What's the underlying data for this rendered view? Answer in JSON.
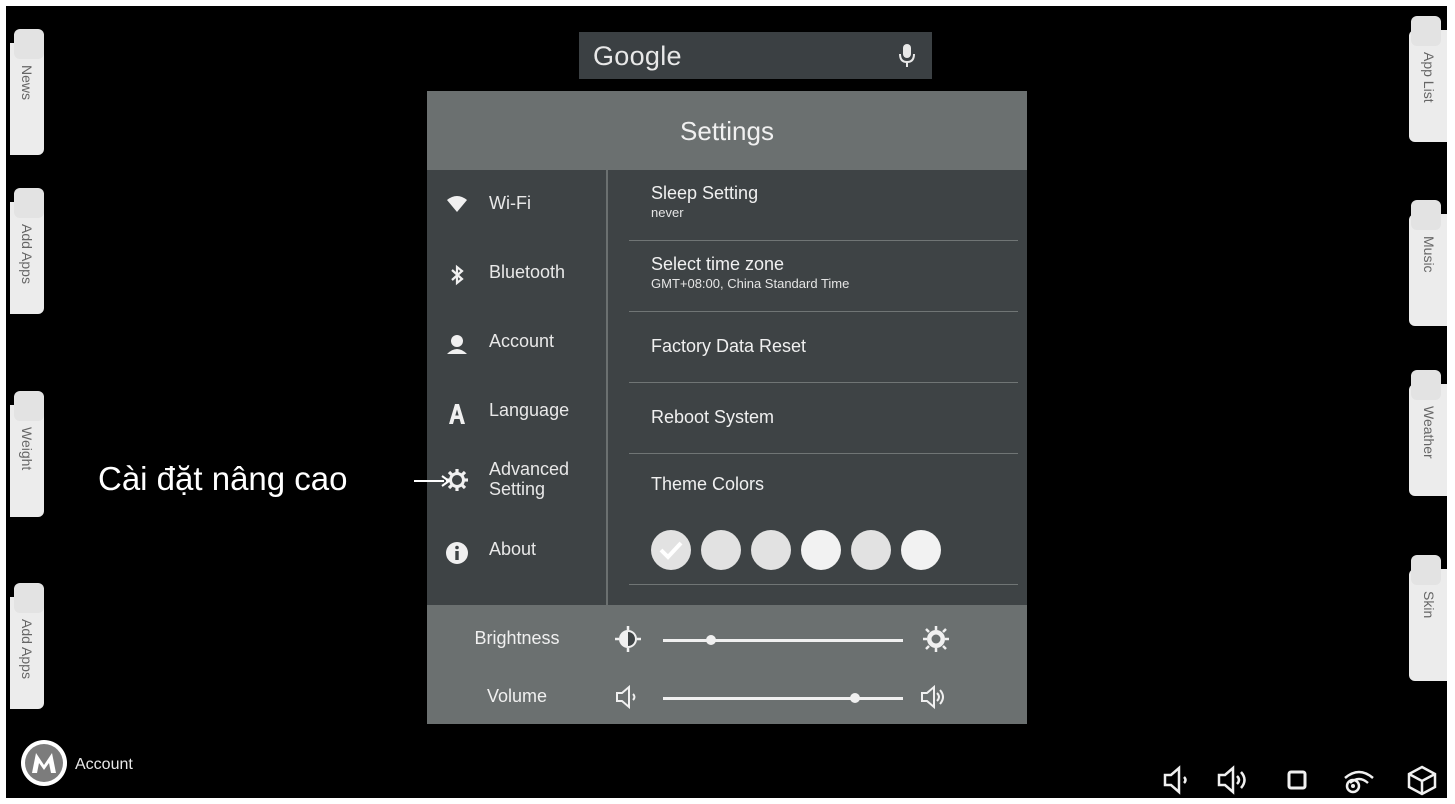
{
  "left_tabs": [
    {
      "label": "News"
    },
    {
      "label": "Add Apps"
    },
    {
      "label": "Weight"
    },
    {
      "label": "Add Apps"
    }
  ],
  "right_tabs": [
    {
      "label": "App List"
    },
    {
      "label": "Music"
    },
    {
      "label": "Weather"
    },
    {
      "label": "Skin"
    }
  ],
  "search": {
    "logo": "Google",
    "icon": "microphone-icon"
  },
  "settings": {
    "title": "Settings",
    "sidebar": [
      {
        "label": "Wi-Fi",
        "icon": "wifi-icon"
      },
      {
        "label": "Bluetooth",
        "icon": "bluetooth-icon"
      },
      {
        "label": "Account",
        "icon": "user-icon"
      },
      {
        "label": "Language",
        "icon": "language-a-icon"
      },
      {
        "label": "Advanced",
        "label2": "Setting",
        "icon": "gear-icon"
      },
      {
        "label": "About",
        "icon": "info-icon"
      }
    ],
    "rows": [
      {
        "title": "Sleep Setting",
        "subtitle": "never"
      },
      {
        "title": "Select time zone",
        "subtitle": "GMT+08:00, China Standard Time"
      },
      {
        "title": "Factory Data Reset"
      },
      {
        "title": "Reboot System"
      },
      {
        "title": "Theme Colors"
      }
    ],
    "theme_colors": {
      "count": 6,
      "selected_index": 0,
      "swatch_color": "#e2e2e2",
      "check_icon": "checkmark-icon"
    },
    "brightness": {
      "label": "Brightness",
      "level": 0.2
    },
    "volume": {
      "label": "Volume",
      "level": 0.8
    }
  },
  "annotation": {
    "text": "Cài đặt nâng cao"
  },
  "account": {
    "label": "Account"
  },
  "system_bar": [
    "volume-down-icon",
    "volume-up-icon",
    "square-icon",
    "wifi-settings-icon",
    "cube-icon"
  ],
  "colors": {
    "background": "#000000",
    "panel_dark": "#3e4345",
    "panel_gray": "#6b7070",
    "tab_bg": "#ececec"
  }
}
